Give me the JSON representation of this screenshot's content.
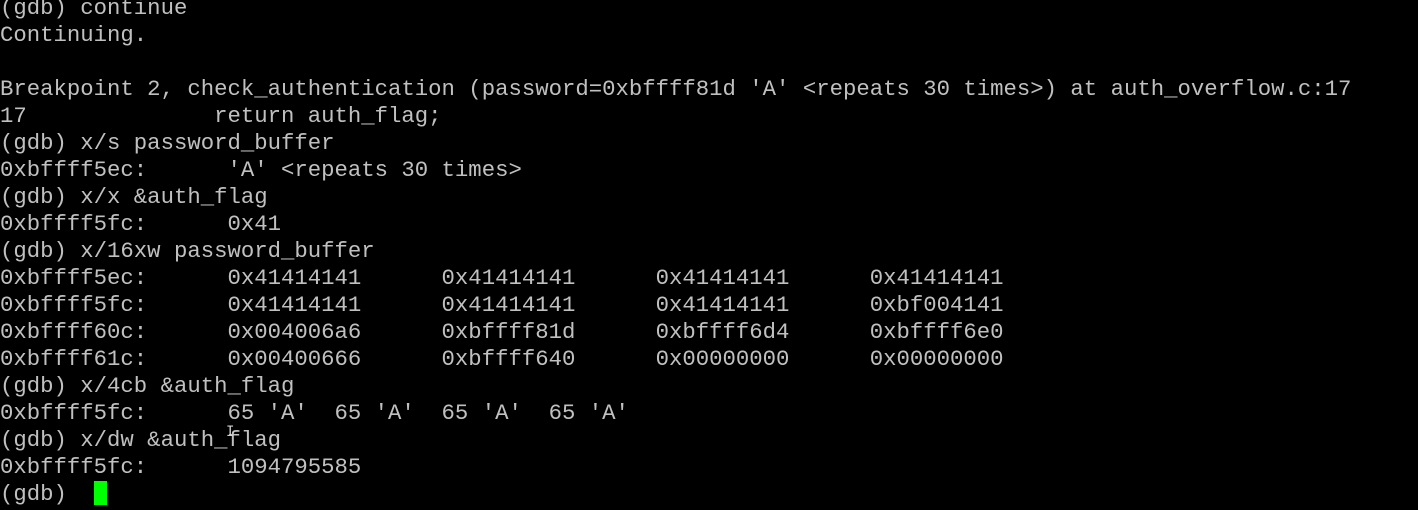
{
  "terminal": {
    "lines": [
      "(gdb) continue",
      "Continuing.",
      "",
      "Breakpoint 2, check_authentication (password=0xbffff81d 'A' <repeats 30 times>) at auth_overflow.c:17",
      "17              return auth_flag;",
      "(gdb) x/s password_buffer",
      "0xbffff5ec:      'A' <repeats 30 times>",
      "(gdb) x/x &auth_flag",
      "0xbffff5fc:      0x41",
      "(gdb) x/16xw password_buffer",
      "0xbffff5ec:      0x41414141      0x41414141      0x41414141      0x41414141",
      "0xbffff5fc:      0x41414141      0x41414141      0x41414141      0xbf004141",
      "0xbffff60c:      0x004006a6      0xbffff81d      0xbffff6d4      0xbffff6e0",
      "0xbffff61c:      0x00400666      0xbffff640      0x00000000      0x00000000",
      "(gdb) x/4cb &auth_flag",
      "0xbffff5fc:      65 'A'  65 'A'  65 'A'  65 'A'",
      "(gdb) x/dw &auth_flag",
      "0xbffff5fc:      1094795585",
      "(gdb) "
    ],
    "cursor_color": "#00ff00",
    "mouse_pointer": "text-cursor-ibeam"
  }
}
